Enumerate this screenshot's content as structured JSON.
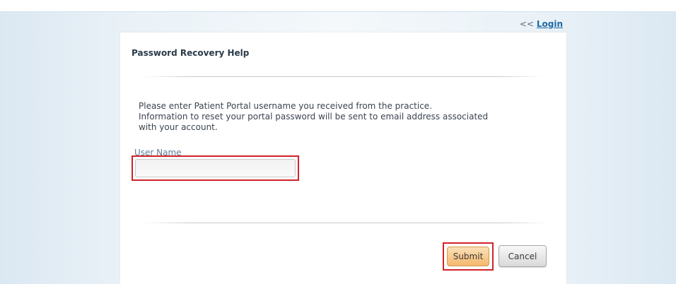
{
  "nav": {
    "back_prefix": "<<",
    "login_label": "Login"
  },
  "dialog": {
    "title": "Password Recovery Help",
    "instructions": [
      "Please enter Patient Portal username you received from the practice.",
      "Information to reset your portal password will be sent to email address associated",
      "with your account."
    ],
    "username": {
      "label": "User Name",
      "value": "",
      "placeholder": ""
    },
    "buttons": {
      "submit": "Submit",
      "cancel": "Cancel"
    }
  },
  "colors": {
    "link": "#1f6aa5",
    "highlight": "#d0232a",
    "submit_bg": "#f5b96e",
    "cancel_bg": "#d9d9d9"
  }
}
